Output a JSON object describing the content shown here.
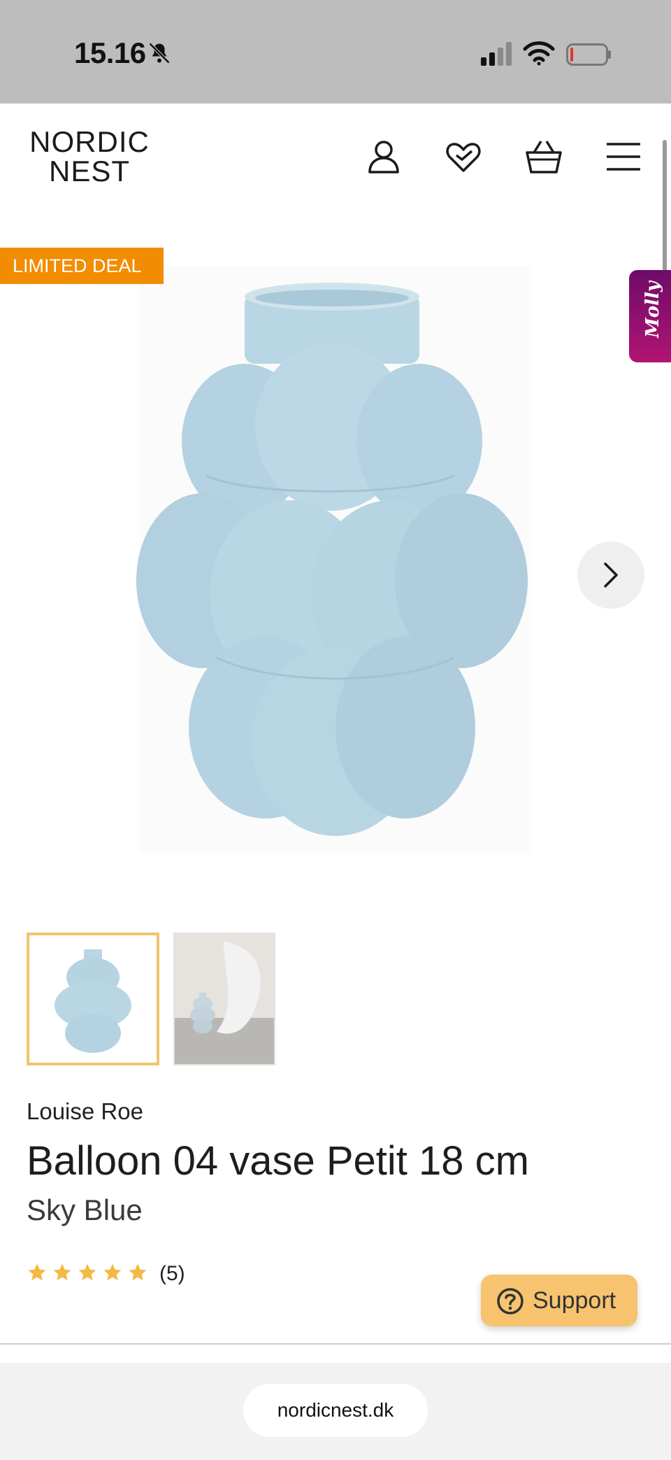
{
  "status_bar": {
    "time": "15.16",
    "icons": [
      "bell-muted-icon",
      "cellular-signal-icon",
      "wifi-icon",
      "battery-icon"
    ]
  },
  "header": {
    "logo_line1": "NORDIC",
    "logo_line2": "NEST",
    "icons": [
      "account-icon",
      "wishlist-heart-icon",
      "basket-icon",
      "menu-icon"
    ]
  },
  "product": {
    "deal_badge": "LIMITED DEAL",
    "side_tab": "Molly",
    "brand": "Louise Roe",
    "title": "Balloon 04 vase Petit 18 cm",
    "variant": "Sky Blue",
    "rating_stars": 5,
    "review_count": "(5)",
    "thumbnail_count": 2,
    "vase_color": "#b9d6e4"
  },
  "support": {
    "label": "Support"
  },
  "browser": {
    "url": "nordicnest.dk"
  },
  "colors": {
    "badge": "#f28c00",
    "star": "#f4b942",
    "support": "#f7c36f",
    "thumb_active_border": "#f2c46d"
  }
}
